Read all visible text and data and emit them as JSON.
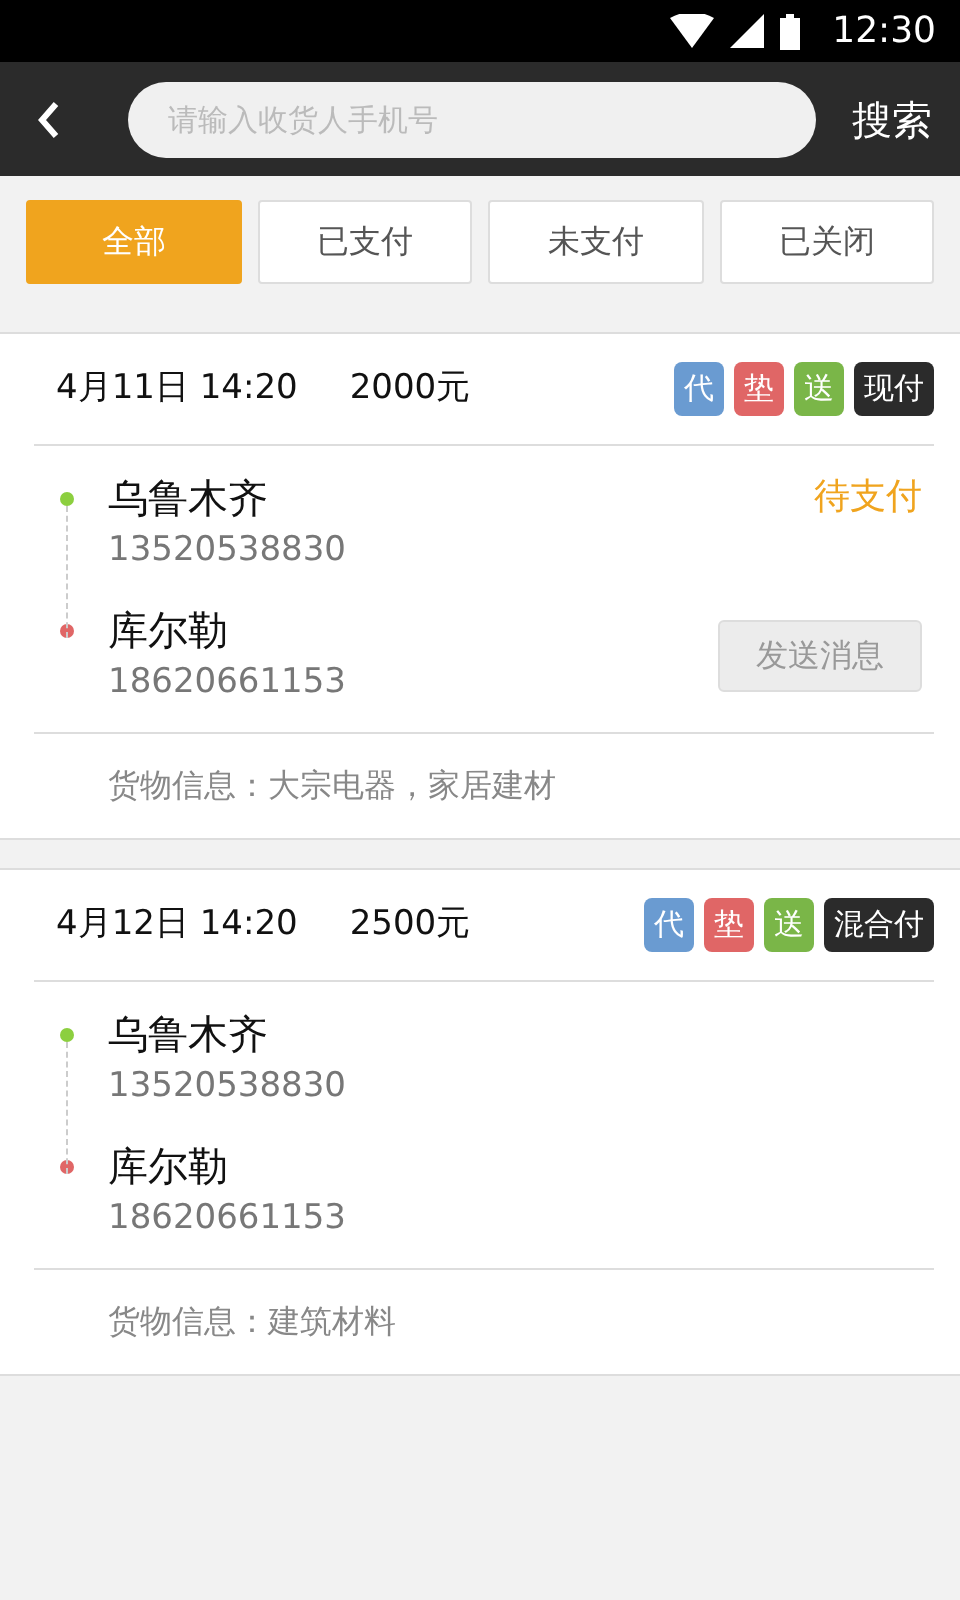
{
  "status_bar": {
    "time": "12:30"
  },
  "toolbar": {
    "search": {
      "placeholder": "请输入收货人手机号"
    },
    "search_button": "搜索"
  },
  "filters": [
    {
      "label": "全部",
      "selected": true
    },
    {
      "label": "已支付",
      "selected": false
    },
    {
      "label": "未支付",
      "selected": false
    },
    {
      "label": "已关闭",
      "selected": false
    }
  ],
  "orders": [
    {
      "time": "4月11日 14:20",
      "amount": "2000元",
      "tags": [
        {
          "label": "代",
          "color": "#6a9bd1"
        },
        {
          "label": "垫",
          "color": "#e06666"
        },
        {
          "label": "送",
          "color": "#7ab648"
        },
        {
          "label": "现付",
          "color": "#2b2b2b"
        }
      ],
      "status": "待支付",
      "stops": [
        {
          "city": "乌鲁木齐",
          "phone": "13520538830",
          "color": "#8ccf3f"
        },
        {
          "city": "库尔勒",
          "phone": "18620661153",
          "color": "#e06666"
        }
      ],
      "action": {
        "label": "发送消息",
        "disabled": true
      },
      "goods": "货物信息：大宗电器，家居建材"
    },
    {
      "time": "4月12日 14:20",
      "amount": "2500元",
      "tags": [
        {
          "label": "代",
          "color": "#6a9bd1"
        },
        {
          "label": "垫",
          "color": "#e06666"
        },
        {
          "label": "送",
          "color": "#7ab648"
        },
        {
          "label": "混合付",
          "color": "#2b2b2b"
        }
      ],
      "stops": [
        {
          "city": "乌鲁木齐",
          "phone": "13520538830",
          "color": "#8ccf3f"
        },
        {
          "city": "库尔勒",
          "phone": "18620661153",
          "color": "#e06666"
        }
      ],
      "goods": "货物信息：建筑材料"
    }
  ]
}
